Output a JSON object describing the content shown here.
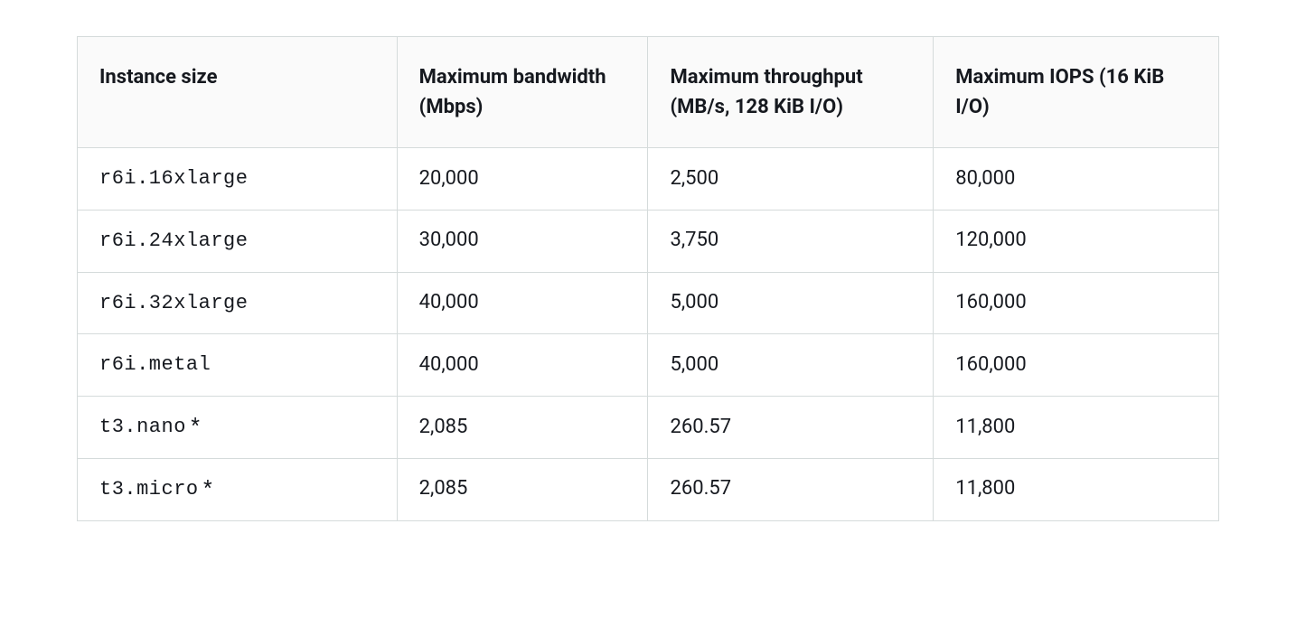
{
  "table": {
    "headers": {
      "instance_size": "Instance size",
      "bandwidth": "Maximum bandwidth (Mbps)",
      "throughput": "Maximum throughput (MB/s, 128 KiB I/O)",
      "iops": "Maximum IOPS (16 KiB I/O)"
    },
    "rows": [
      {
        "instance": "r6i.16xlarge",
        "suffix": "",
        "bandwidth": "20,000",
        "throughput": "2,500",
        "iops": "80,000"
      },
      {
        "instance": "r6i.24xlarge",
        "suffix": "",
        "bandwidth": "30,000",
        "throughput": "3,750",
        "iops": "120,000"
      },
      {
        "instance": "r6i.32xlarge",
        "suffix": "",
        "bandwidth": "40,000",
        "throughput": "5,000",
        "iops": "160,000"
      },
      {
        "instance": "r6i.metal",
        "suffix": "",
        "bandwidth": "40,000",
        "throughput": "5,000",
        "iops": "160,000"
      },
      {
        "instance": "t3.nano",
        "suffix": " *",
        "bandwidth": "2,085",
        "throughput": "260.57",
        "iops": "11,800"
      },
      {
        "instance": "t3.micro",
        "suffix": " *",
        "bandwidth": "2,085",
        "throughput": "260.57",
        "iops": "11,800"
      }
    ]
  }
}
